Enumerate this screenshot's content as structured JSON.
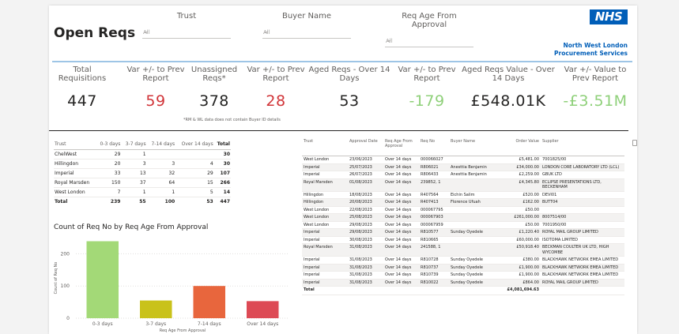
{
  "title": "Open Reqs",
  "slicers": [
    {
      "label": "Trust",
      "value": "All"
    },
    {
      "label": "Buyer Name",
      "value": "All"
    },
    {
      "label": "Req Age From Approval",
      "value": "All"
    }
  ],
  "logo": "NHS",
  "org": {
    "line1": "North West London",
    "line2": "Procurement Services"
  },
  "kpis": [
    {
      "label": "Total Requisitions",
      "value": "447",
      "color": "#252423"
    },
    {
      "label": "Var +/- to Prev Report",
      "value": "59",
      "color": "#d13438"
    },
    {
      "label": "Unassigned Reqs*",
      "value": "378",
      "color": "#252423"
    },
    {
      "label": "Var +/- to Prev Report",
      "value": "28",
      "color": "#d13438"
    },
    {
      "label": "Aged Reqs - Over 14 Days",
      "value": "53",
      "color": "#252423"
    },
    {
      "label": "Var +/- to Prev Report",
      "value": "-179",
      "color": "#8fd07a"
    },
    {
      "label": "Aged Reqs Value - Over 14 Days",
      "value": "£548.01K",
      "color": "#252423"
    },
    {
      "label": "Var +/- Value to Prev Report",
      "value": "-£3.51M",
      "color": "#8fd07a"
    }
  ],
  "note": "*RM & WL data does not contain Buyer ID details",
  "matrix": {
    "headers": [
      "Trust",
      "0-3 days",
      "3-7 days",
      "7-14 days",
      "Over 14 days",
      "Total"
    ],
    "rows": [
      [
        "ChelWest",
        "29",
        "1",
        "",
        "",
        "30"
      ],
      [
        "Hillingdon",
        "20",
        "3",
        "3",
        "4",
        "30"
      ],
      [
        "Imperial",
        "33",
        "13",
        "32",
        "29",
        "107"
      ],
      [
        "Royal Marsden",
        "150",
        "37",
        "64",
        "15",
        "266"
      ],
      [
        "West London",
        "7",
        "1",
        "1",
        "5",
        "14"
      ]
    ],
    "total": [
      "Total",
      "239",
      "55",
      "100",
      "53",
      "447"
    ]
  },
  "chart_data": {
    "type": "bar",
    "title": "Count of Req No by Req Age From Approval",
    "categories": [
      "0-3 days",
      "3-7 days",
      "7-14 days",
      "Over 14 days"
    ],
    "values": [
      239,
      55,
      100,
      53
    ],
    "colors": [
      "#a3d977",
      "#c9c21a",
      "#e8663d",
      "#dd4a55"
    ],
    "xlabel": "Req Age From Approval",
    "ylabel": "Count of Req No",
    "ylim": [
      0,
      250
    ],
    "yticks": [
      0,
      100,
      200
    ],
    "grid": true
  },
  "detail": {
    "headers": [
      "Trust",
      "Approval Date",
      "Req Age From Approval",
      "Req No",
      "Buyer Name",
      "Order Value",
      "Supplier"
    ],
    "rows": [
      [
        "West London",
        "23/06/2023",
        "Over 14 days",
        "000066027",
        "",
        "£5,481.00",
        "7001825/00"
      ],
      [
        "Imperial",
        "25/07/2023",
        "Over 14 days",
        "R806021",
        "Anesttia Benjamin",
        "£34,000.00",
        "LONDON CORE LABORATORY LTD (LCL)"
      ],
      [
        "Imperial",
        "26/07/2023",
        "Over 14 days",
        "R806433",
        "Anesttia Benjamin",
        "£2,259.00",
        "GBUK LTD"
      ],
      [
        "Royal Marsden",
        "01/08/2023",
        "Over 14 days",
        "239852, 1",
        "",
        "£4,345.80",
        "ECLIPSE PRESENTATIONS LTD, BECKENHAM"
      ],
      [
        "Hillingdon",
        "18/08/2023",
        "Over 14 days",
        "R407564",
        "Eichin Salim",
        "£520.00",
        "DEVI01"
      ],
      [
        "Hillingdon",
        "20/08/2023",
        "Over 14 days",
        "R407413",
        "Florence Ufuah",
        "£162.00",
        "BUTT04"
      ],
      [
        "West London",
        "22/08/2023",
        "Over 14 days",
        "000067795",
        "",
        "£50.00",
        ""
      ],
      [
        "West London",
        "25/08/2023",
        "Over 14 days",
        "000067903",
        "",
        "£261,000.00",
        "8007514/00"
      ],
      [
        "West London",
        "29/08/2023",
        "Over 14 days",
        "000067959",
        "",
        "£50.00",
        "7001950/00"
      ],
      [
        "Imperial",
        "29/08/2023",
        "Over 14 days",
        "R810577",
        "Sunday Oyedele",
        "£1,220.40",
        "ROYAL MAIL GROUP LIMITED"
      ],
      [
        "Imperial",
        "30/08/2023",
        "Over 14 days",
        "R810665",
        "",
        "£60,000.00",
        "ISOTOMA LIMITED"
      ],
      [
        "Royal Marsden",
        "31/08/2023",
        "Over 14 days",
        "241588, 1",
        "",
        "£50,918.40",
        "BECKMAN COULTER UK LTD, HIGH WYCOMBE"
      ],
      [
        "Imperial",
        "31/08/2023",
        "Over 14 days",
        "R810728",
        "Sunday Oyedele",
        "£380.00",
        "BLACKHAWK NETWORK EMEA LIMITED"
      ],
      [
        "Imperial",
        "31/08/2023",
        "Over 14 days",
        "R810737",
        "Sunday Oyedele",
        "£1,900.00",
        "BLACKHAWK NETWORK EMEA LIMITED"
      ],
      [
        "Imperial",
        "31/08/2023",
        "Over 14 days",
        "R810739",
        "Sunday Oyedele",
        "£1,900.00",
        "BLACKHAWK NETWORK EMEA LIMITED"
      ],
      [
        "Imperial",
        "31/08/2023",
        "Over 14 days",
        "R810022",
        "Sunday Oyedele",
        "£864.00",
        "ROYAL MAIL GROUP LIMITED"
      ]
    ],
    "total_label": "Total",
    "total_value": "£4,081,694.63"
  }
}
